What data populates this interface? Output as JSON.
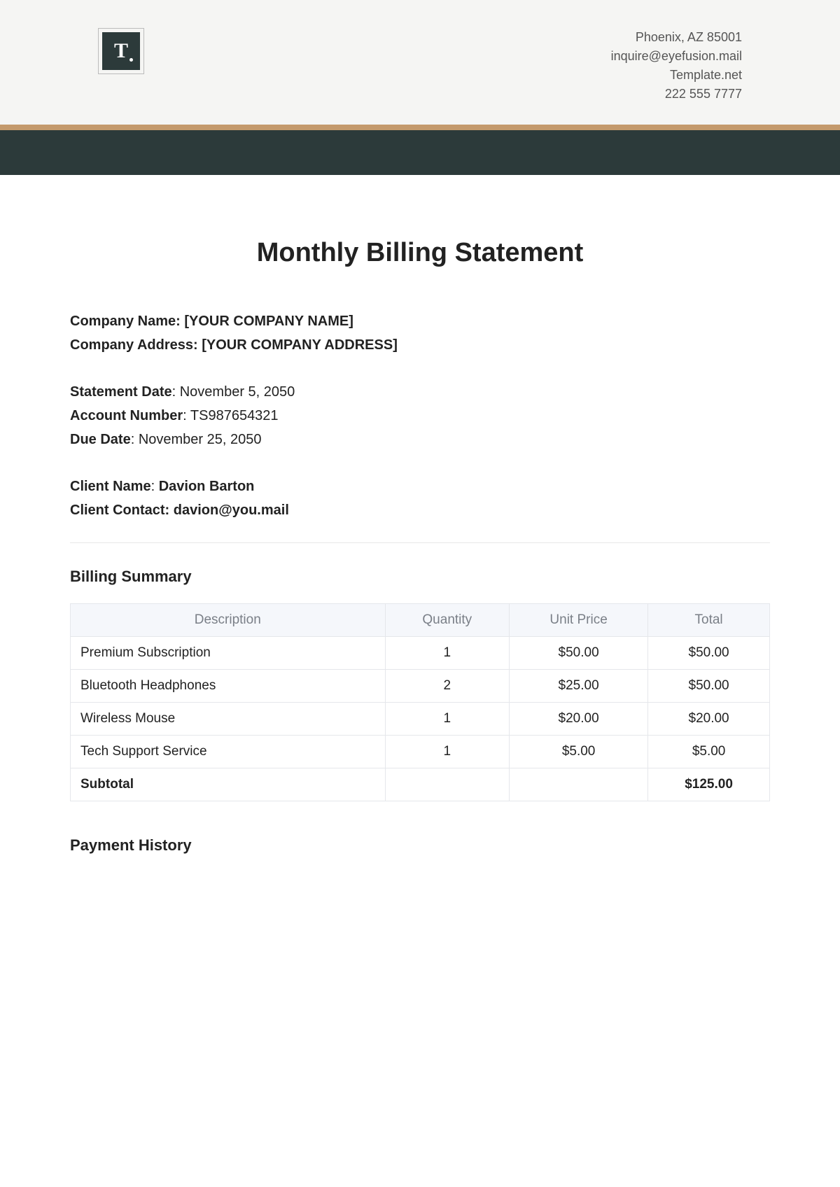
{
  "header": {
    "address": "Phoenix, AZ 85001",
    "email": "inquire@eyefusion.mail",
    "site": "Template.net",
    "phone": "222 555 7777"
  },
  "title": "Monthly Billing Statement",
  "company": {
    "name_label": "Company Name:",
    "name_value": "[YOUR COMPANY NAME]",
    "address_label": "Company Address:",
    "address_value": "[YOUR COMPANY ADDRESS]"
  },
  "statement": {
    "date_label": "Statement Date",
    "date_value": "November 5, 2050",
    "account_label": "Account Number",
    "account_value": "TS987654321",
    "due_label": "Due Date",
    "due_value": "November 25, 2050"
  },
  "client": {
    "name_label": "Client Name",
    "name_value": "Davion Barton",
    "contact_label": "Client Contact:",
    "contact_value": "davion@you.mail"
  },
  "billing_summary": {
    "title": "Billing Summary",
    "headers": {
      "description": "Description",
      "quantity": "Quantity",
      "unit_price": "Unit Price",
      "total": "Total"
    },
    "rows": [
      {
        "desc": "Premium Subscription",
        "qty": "1",
        "unit": "$50.00",
        "total": "$50.00"
      },
      {
        "desc": "Bluetooth Headphones",
        "qty": "2",
        "unit": "$25.00",
        "total": "$50.00"
      },
      {
        "desc": "Wireless Mouse",
        "qty": "1",
        "unit": "$20.00",
        "total": "$20.00"
      },
      {
        "desc": "Tech Support Service",
        "qty": "1",
        "unit": "$5.00",
        "total": "$5.00"
      }
    ],
    "subtotal_label": "Subtotal",
    "subtotal_value": "$125.00"
  },
  "payment_history": {
    "title": "Payment History"
  }
}
